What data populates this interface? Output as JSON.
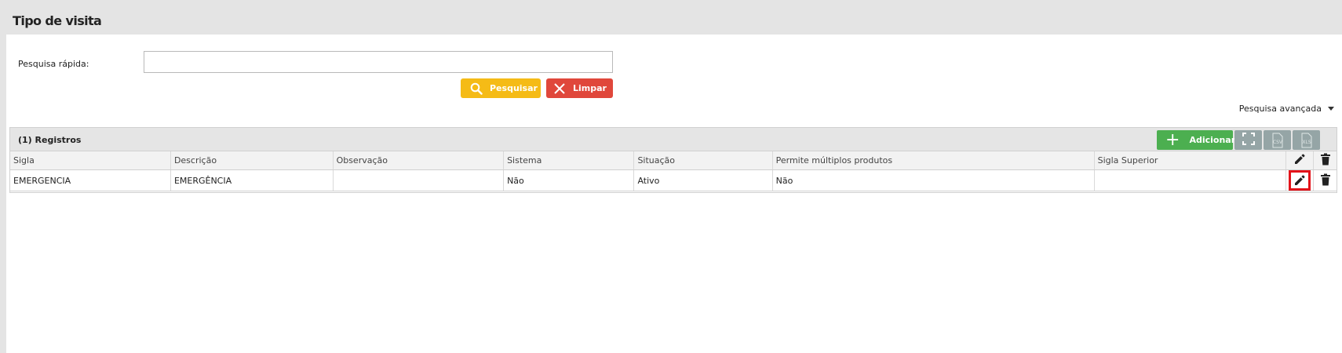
{
  "page": {
    "title": "Tipo de visita"
  },
  "search": {
    "label": "Pesquisa rápida:",
    "value": "",
    "placeholder": "",
    "search_button": "Pesquisar",
    "clear_button": "Limpar",
    "advanced_label": "Pesquisa avançada"
  },
  "grid": {
    "records_label": "(1) Registros",
    "add_button": "Adicionar",
    "csv_label": "CSV",
    "xls_label": "XLS",
    "columns": [
      "Sigla",
      "Descrição",
      "Observação",
      "Sistema",
      "Situação",
      "Permite múltiplos produtos",
      "Sigla Superior"
    ],
    "rows": [
      [
        "EMERGENCIA",
        "EMERGÊNCIA",
        "",
        "Não",
        "Ativo",
        "Não",
        ""
      ]
    ]
  },
  "colors": {
    "search_button": "#f5bb16",
    "clear_button": "#e0473b",
    "add_button": "#4caf50",
    "tool_buttons": "#95a5a6",
    "highlight": "#e3131a"
  },
  "icons": [
    "search-icon",
    "close-icon",
    "plus-icon",
    "expand-icon",
    "csv-icon",
    "xls-icon",
    "edit-icon",
    "trash-icon",
    "caret-down-icon"
  ]
}
